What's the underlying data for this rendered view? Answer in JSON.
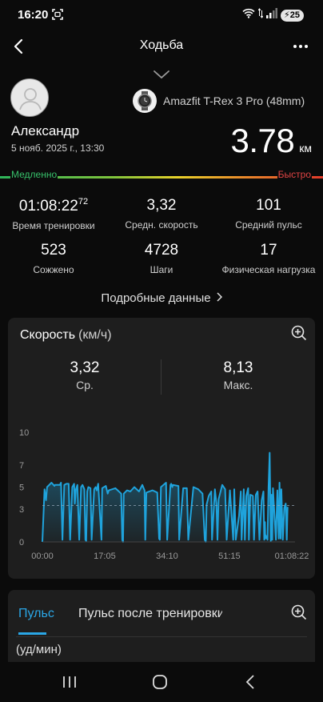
{
  "status_bar": {
    "time": "16:20",
    "battery": "25"
  },
  "header": {
    "title": "Ходьба"
  },
  "device": {
    "name": "Amazfit T-Rex 3 Pro (48mm)"
  },
  "workout": {
    "user_name": "Александр",
    "date": "5 нояб. 2025 г., 13:30",
    "distance": "3.78",
    "distance_unit": "км"
  },
  "intensity": {
    "slow_label": "Медленно",
    "fast_label": "Быстро"
  },
  "stats": [
    {
      "value": "01:08:22",
      "sup": "72",
      "label": "Время тренировки"
    },
    {
      "value": "3,32",
      "label": "Средн. скорость"
    },
    {
      "value": "101",
      "label": "Средний пульс"
    },
    {
      "value": "523",
      "label": "Сожжено"
    },
    {
      "value": "4728",
      "label": "Шаги"
    },
    {
      "value": "17",
      "label": "Физическая нагрузка"
    }
  ],
  "details_link": "Подробные данные",
  "speed_card": {
    "title": "Скорость",
    "unit": "(км/ч)",
    "avg_value": "3,32",
    "avg_label": "Ср.",
    "max_value": "8,13",
    "max_label": "Макс."
  },
  "chart_data": {
    "type": "area",
    "title": "Скорость",
    "ylabel": "(км/ч)",
    "ylim": [
      0,
      10
    ],
    "y_ticks": [
      "10",
      "7",
      "5",
      "3",
      "0"
    ],
    "y_tick_values": [
      10,
      7,
      5,
      3,
      0
    ],
    "x_ticks": [
      "00:00",
      "17:05",
      "34:10",
      "51:15",
      "01:08:22"
    ],
    "x_range_minutes": [
      0,
      68.37
    ],
    "average_line": 3.32,
    "color": "#1fa3dc",
    "series": [
      {
        "x": [
          0,
          0.6,
          1.0,
          1.3,
          2.5,
          3.3,
          3.5,
          4.8,
          5.1,
          5.5,
          6.0,
          6.6,
          7.2,
          7.6,
          8.2,
          8.7,
          8.9,
          9.2,
          9.6,
          10.1,
          10.6,
          11.0,
          11.5,
          11.8,
          12.0,
          12.3,
          12.6,
          13.2,
          13.5,
          14.2,
          14.6,
          14.9,
          15.3,
          16.2,
          16.4,
          17.4,
          17.9,
          18.2,
          20.0,
          21.6,
          21.9,
          22.1,
          22.3,
          23.2,
          24.1,
          25.2,
          26.5,
          27.4,
          28.0,
          28.2,
          28.5,
          30.2,
          31.5,
          32.0,
          32.2,
          32.5,
          33.9,
          34.2,
          35.1,
          35.3,
          35.6,
          35.8,
          37.3,
          37.5,
          38.6,
          39.6,
          40.0,
          41.4,
          42.7,
          43.9,
          44.5,
          44.8,
          45.0,
          45.6,
          46.3,
          46.5,
          47.3,
          47.7,
          48.0,
          48.3,
          49.3,
          50.1,
          50.5,
          51.2,
          51.4,
          52.3,
          52.6,
          53.0,
          53.9,
          54.4,
          54.6,
          55.2,
          55.5,
          55.9,
          56.4,
          56.6,
          57.0,
          57.7,
          58.0,
          58.5,
          59.0,
          59.5,
          60.1,
          60.6,
          60.8,
          61.0,
          61.1,
          61.2,
          61.7,
          62.0,
          62.3,
          62.6,
          62.8,
          63.0,
          63.2,
          63.6,
          64.0,
          64.4,
          64.8,
          65.0,
          65.3,
          65.5,
          65.9,
          66.3,
          66.7,
          67.0,
          67.2
        ],
        "values": [
          0,
          4.8,
          3.8,
          5.0,
          5.4,
          5.1,
          5.2,
          5.2,
          5.4,
          0.2,
          5.2,
          5.3,
          5.3,
          0.2,
          5.0,
          5.3,
          3.5,
          4.8,
          5.2,
          0.2,
          5.0,
          5.2,
          4.8,
          0.2,
          0.1,
          4.6,
          5.0,
          4.9,
          0.2,
          4.8,
          5.0,
          4.7,
          5.3,
          0.2,
          4.9,
          5.1,
          4.4,
          4.7,
          4.9,
          4.4,
          0.2,
          0,
          4.4,
          4.7,
          4.6,
          5.0,
          4.6,
          5.2,
          4.7,
          0.2,
          4.5,
          4.7,
          4.5,
          0.3,
          0.2,
          5.0,
          5.4,
          0.2,
          5.2,
          5.3,
          5.0,
          5.2,
          5.1,
          0.2,
          4.9,
          4.9,
          0.2,
          5.0,
          4.8,
          4.4,
          0.2,
          0,
          3.4,
          4.2,
          4.6,
          0.2,
          4.8,
          3.5,
          0.2,
          3.9,
          5.2,
          4.8,
          0.2,
          3.6,
          4.7,
          0.2,
          4.8,
          0.2,
          2.4,
          4.6,
          0.2,
          4.8,
          0.2,
          4.2,
          4.9,
          0.2,
          4.3,
          4.2,
          0.2,
          4.3,
          4.6,
          0.2,
          3.8,
          4.6,
          0.2,
          1.8,
          0.3,
          0.6,
          0.2,
          5.0,
          8.13,
          0.1,
          4.3,
          0.2,
          4.9,
          2.6,
          0.2,
          4.7,
          0.3,
          5.4,
          0.3,
          4.8,
          0.2,
          3.1,
          3.5,
          0.2,
          3.2
        ]
      }
    ]
  },
  "pulse_card": {
    "tab_active": "Пульс",
    "tab_other": "Пульс после тренировки",
    "unit_label": "(уд/мин)"
  }
}
